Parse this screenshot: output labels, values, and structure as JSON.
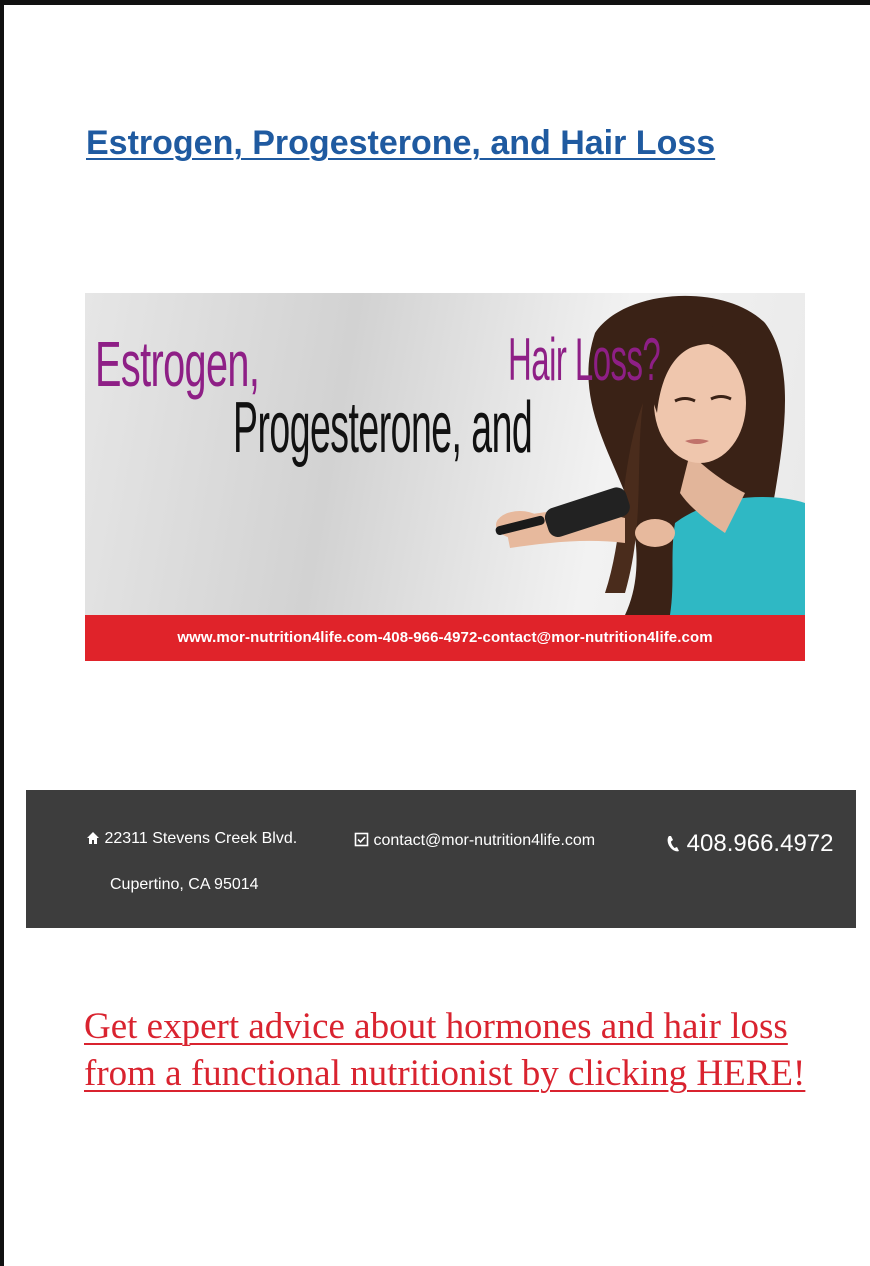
{
  "title": "Estrogen, Progesterone, and Hair Loss",
  "banner": {
    "word1": "Estrogen,",
    "word2": "Progesterone, and",
    "word3": "Hair Loss?",
    "footer": "www.mor-nutrition4life.com-408-966-4972-contact@mor-nutrition4life.com"
  },
  "info": {
    "address_line1": "22311 Stevens Creek Blvd.",
    "address_line2": "Cupertino, CA 95014",
    "email": "contact@mor-nutrition4life.com",
    "phone": "408.966.4972"
  },
  "cta": "Get expert advice about hormones and hair loss from a functional nutritionist by clicking HERE!"
}
